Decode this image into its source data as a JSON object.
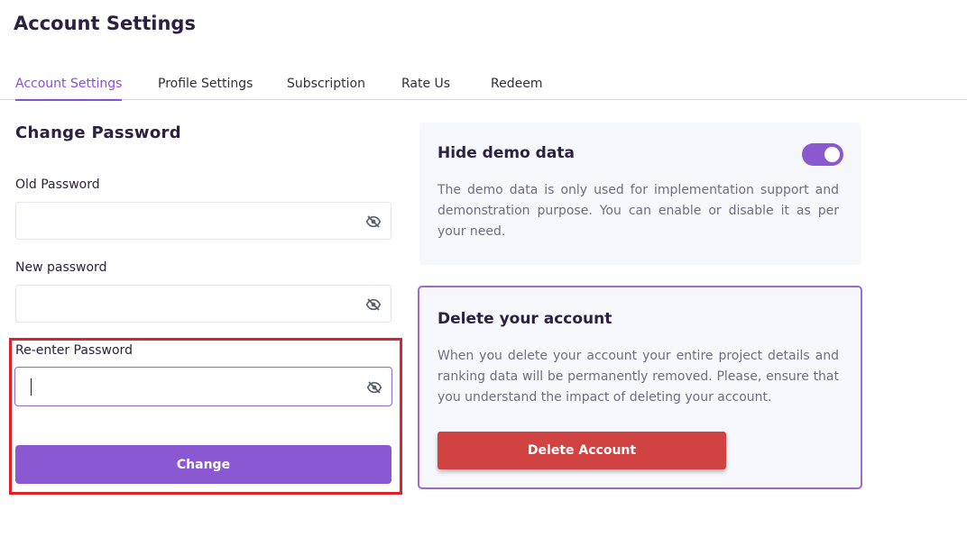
{
  "page": {
    "title": "Account Settings"
  },
  "tabs": [
    {
      "label": "Account Settings",
      "active": true
    },
    {
      "label": "Profile Settings",
      "active": false
    },
    {
      "label": "Subscription",
      "active": false
    },
    {
      "label": "Rate Us",
      "active": false
    },
    {
      "label": "Redeem",
      "active": false
    }
  ],
  "password_form": {
    "title": "Change Password",
    "old_password": {
      "label": "Old Password",
      "value": "",
      "icon": "eye-off-icon"
    },
    "new_password": {
      "label": "New password",
      "value": "",
      "icon": "eye-off-icon"
    },
    "reenter_password": {
      "label": "Re-enter Password",
      "value": "",
      "icon": "eye-off-icon",
      "focused": true
    },
    "submit_label": "Change"
  },
  "demo_card": {
    "title": "Hide demo data",
    "description": "The demo data is only used for implementation support and demonstration purpose. You can enable or disable it as per your need.",
    "toggle_on": true
  },
  "delete_card": {
    "title": "Delete your account",
    "description": "When you delete your account your entire project details and ranking data will be permanently removed. Please, ensure that you understand the impact of deleting your account.",
    "button_label": "Delete Account"
  },
  "colors": {
    "accent": "#8a58d1",
    "danger": "#d14343",
    "highlight": "#e0202a"
  }
}
